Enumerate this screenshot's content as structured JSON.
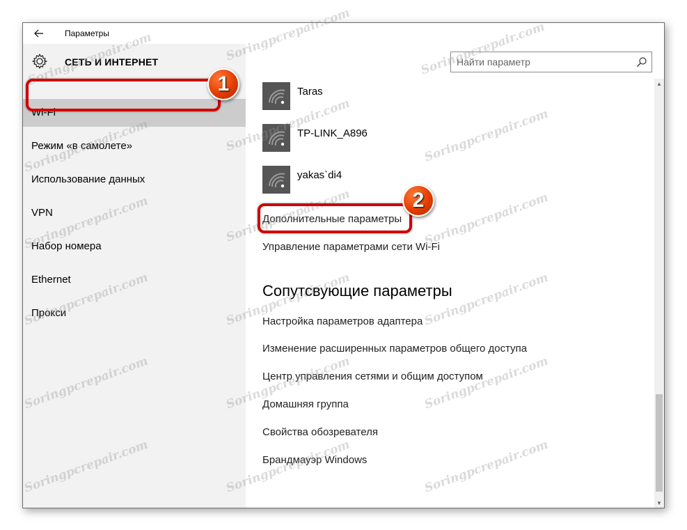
{
  "window": {
    "title": "Параметры",
    "section_title": "СЕТЬ И ИНТЕРНЕТ"
  },
  "search": {
    "placeholder": "Найти параметр"
  },
  "sidebar": {
    "items": [
      {
        "label": "Wi-Fi",
        "selected": true
      },
      {
        "label": "Режим «в самолете»"
      },
      {
        "label": "Использование данных"
      },
      {
        "label": "VPN"
      },
      {
        "label": "Набор номера"
      },
      {
        "label": "Ethernet"
      },
      {
        "label": "Прокси"
      }
    ]
  },
  "networks": [
    {
      "name": "Taras",
      "icon": "wifi-signal-icon"
    },
    {
      "name": "TP-LINK_A896",
      "icon": "wifi-signal-icon"
    },
    {
      "name": "yakas`di4",
      "icon": "wifi-signal-icon"
    }
  ],
  "links": {
    "advanced": "Дополнительные параметры",
    "manage": "Управление параметрами сети Wi-Fi"
  },
  "related": {
    "heading": "Сопутсвующие параметры",
    "items": [
      "Настройка параметров адаптера",
      "Изменение расширенных параметров общего доступа",
      "Центр управления сетями и общим доступом",
      "Домашняя группа",
      "Свойства обозревателя",
      "Брандмауэр Windows"
    ]
  },
  "annotations": {
    "badge_1": "1",
    "badge_2": "2",
    "callout_color": "#d10000",
    "badge_color": "#e43d00"
  },
  "watermark": {
    "text": "Soringpcrepair.com"
  }
}
